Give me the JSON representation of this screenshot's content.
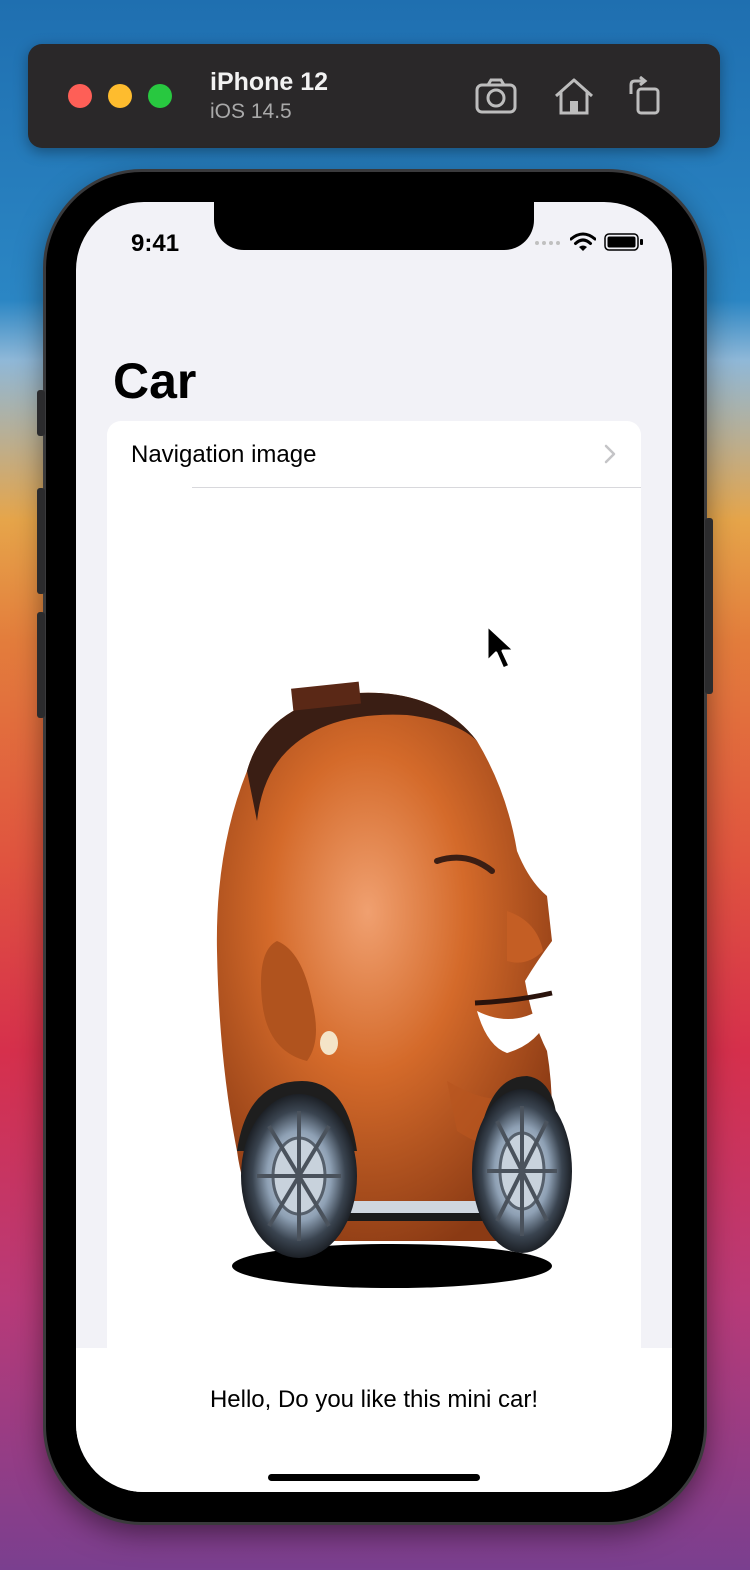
{
  "simulator": {
    "device_name": "iPhone 12",
    "os_version": "iOS 14.5",
    "toolbar_icons": [
      "screenshot-icon",
      "home-icon",
      "rotate-icon"
    ],
    "traffic_lights": {
      "close": "#fe5f57",
      "minimize": "#febc2e",
      "zoom": "#28c840"
    }
  },
  "status_bar": {
    "time": "9:41",
    "icons": [
      "signal-icon",
      "wifi-icon",
      "battery-icon"
    ]
  },
  "nav": {
    "large_title": "Car"
  },
  "list": {
    "items": [
      {
        "label": "Navigation image",
        "icon": "chevron-right-icon"
      }
    ]
  },
  "content": {
    "image": "car-with-face-image"
  },
  "bottom": {
    "text": "Hello, Do you like this mini car!"
  }
}
